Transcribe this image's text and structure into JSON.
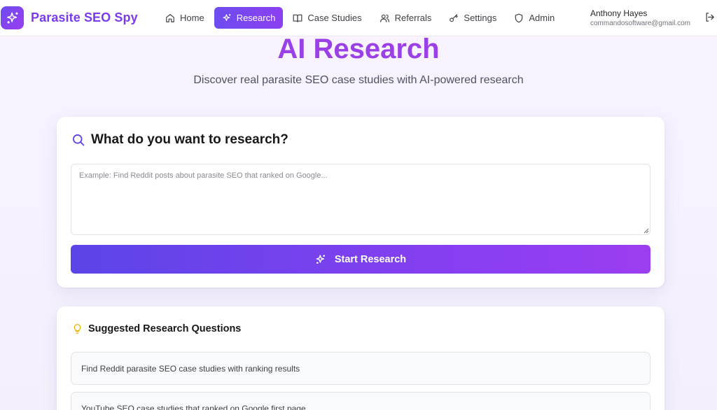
{
  "app": {
    "brand": "Parasite SEO Spy"
  },
  "nav": {
    "items": [
      {
        "label": "Home",
        "icon": "home-icon",
        "active": false
      },
      {
        "label": "Research",
        "icon": "sparkles-icon",
        "active": true
      },
      {
        "label": "Case Studies",
        "icon": "book-open-icon",
        "active": false
      },
      {
        "label": "Referrals",
        "icon": "users-icon",
        "active": false
      },
      {
        "label": "Settings",
        "icon": "key-icon",
        "active": false
      },
      {
        "label": "Admin",
        "icon": "shield-icon",
        "active": false
      }
    ]
  },
  "user": {
    "name": "Anthony Hayes",
    "email": "commandosoftware@gmail.com"
  },
  "hero": {
    "title": "AI Research",
    "subtitle": "Discover real parasite SEO case studies with AI-powered research"
  },
  "research": {
    "heading": "What do you want to research?",
    "placeholder": "Example: Find Reddit posts about parasite SEO that ranked on Google...",
    "value": "",
    "button_label": "Start Research"
  },
  "suggestions": {
    "heading": "Suggested Research Questions",
    "items": [
      "Find Reddit parasite SEO case studies with ranking results",
      "YouTube SEO case studies that ranked on Google first page"
    ]
  },
  "colors": {
    "brand": "#7c3aed",
    "accent_start": "#5b45e8",
    "accent_end": "#9b3ef0",
    "title": "#9b3fe6",
    "bulb": "#eab308"
  }
}
